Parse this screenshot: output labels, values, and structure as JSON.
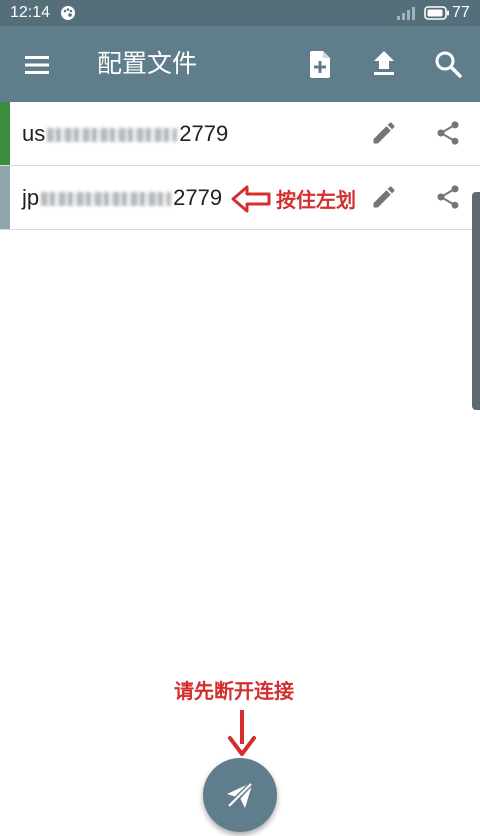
{
  "status_bar": {
    "time": "12:14",
    "battery": "77"
  },
  "app_bar": {
    "title": "配置文件",
    "menu_icon": "hamburger-menu-icon",
    "actions": [
      "new-file-icon",
      "upload-icon",
      "search-icon"
    ],
    "color": "#607d8b"
  },
  "profiles": [
    {
      "name_prefix": "us",
      "name_suffix": "2779",
      "stripe_color": "#388e3c",
      "active": true
    },
    {
      "name_prefix": "jp",
      "name_suffix": "2779",
      "stripe_color": "#90a4ae",
      "active": false
    }
  ],
  "annotations": {
    "swipe_hint": "按住左划",
    "disconnect_hint": "请先断开连接",
    "color": "#d32f2f"
  },
  "fab": {
    "icon": "paper-plane-off-icon"
  }
}
